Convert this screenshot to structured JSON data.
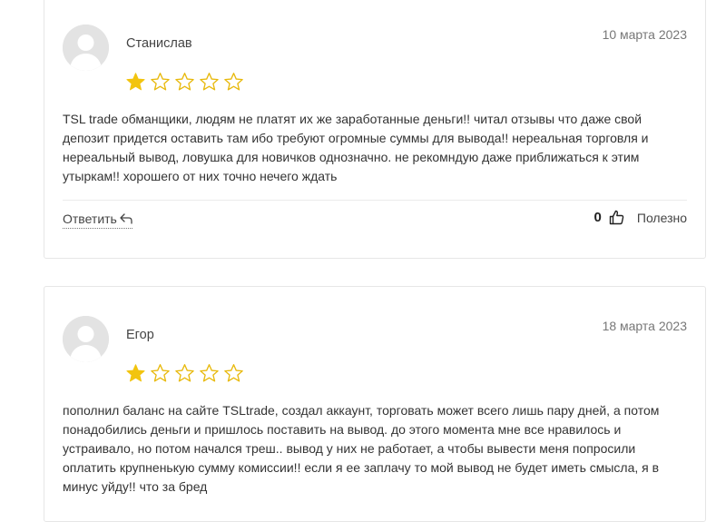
{
  "reviews": [
    {
      "author": "Станислав",
      "date": "10 марта 2023",
      "rating": 1,
      "max_rating": 5,
      "text": "TSL trade обманщики, людям не платят их же заработанные деньги!! читал отзывы что даже свой депозит придется оставить там ибо требуют огромные суммы для вывода!! нереальная торговля и нереальный вывод, ловушка для новичков однозначно. не рекомндую даже приближаться к этим утыркам!! хорошего от них точно нечего ждать",
      "reply_label": "Ответить",
      "helpful_count": "0",
      "helpful_label": "Полезно"
    },
    {
      "author": "Егор",
      "date": "18 марта 2023",
      "rating": 1,
      "max_rating": 5,
      "text": "пополнил баланс на сайте TSLtrade, создал аккаунт, торговать может всего лишь пару дней, а потом понадобились деньги и пришлось поставить на вывод. до этого момента мне все нравилось и устраивало, но потом начался треш.. вывод у них не работает, а чтобы вывести меня попросили оплатить крупненькую сумму комиссии!! если я ее заплачу то мой вывод не будет иметь смысла, я в минус уйду!! что за бред"
    }
  ],
  "colors": {
    "star_filled": "#f2c40f",
    "star_empty_outline": "#e8b90d",
    "card_border": "#e6e6e6",
    "avatar_bg": "#e3e3e3"
  },
  "icons": {
    "avatar": "user-silhouette-icon",
    "star": "star-icon",
    "reply": "reply-arrow-icon",
    "thumb": "thumbs-up-icon"
  }
}
